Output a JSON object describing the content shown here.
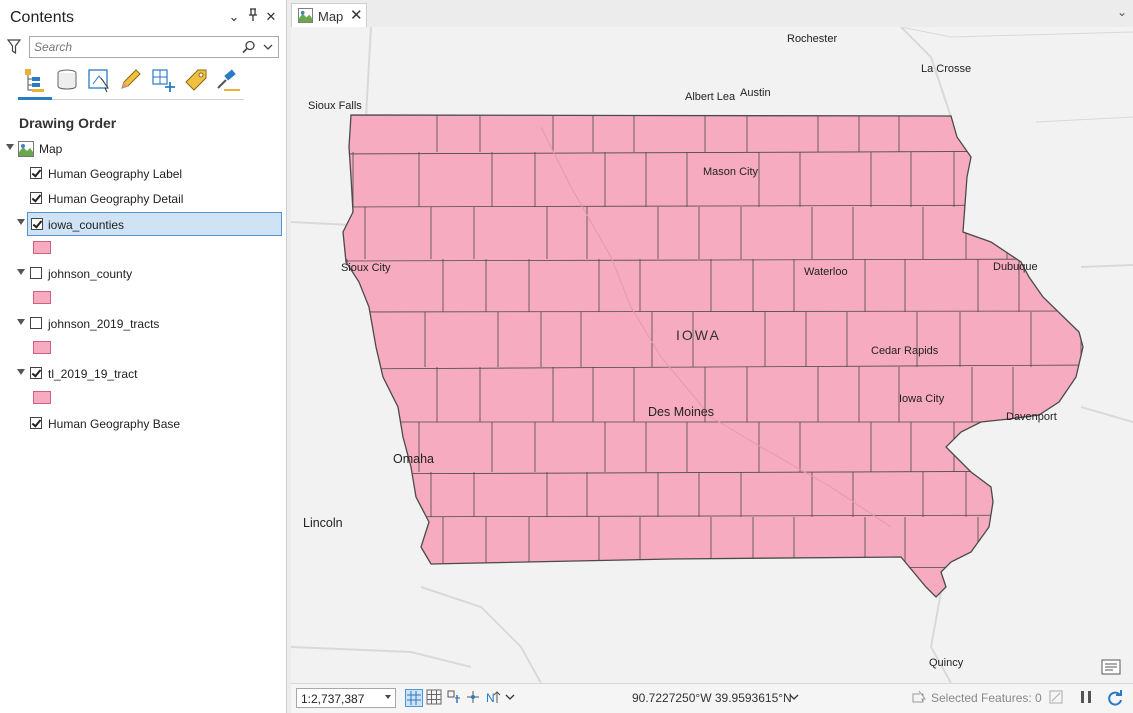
{
  "contents_pane": {
    "title": "Contents",
    "search": {
      "placeholder": "Search",
      "value": ""
    },
    "section_title": "Drawing Order",
    "map_node": "Map",
    "layers": [
      {
        "name": "Human Geography Label",
        "checked": true
      },
      {
        "name": "Human Geography Detail",
        "checked": true
      },
      {
        "name": "iowa_counties",
        "checked": true,
        "selected": true,
        "symbol_color": "#f7abc0"
      },
      {
        "name": "johnson_county",
        "checked": false,
        "symbol_color": "#f7abc0"
      },
      {
        "name": "johnson_2019_tracts",
        "checked": false,
        "symbol_color": "#f7abc0"
      },
      {
        "name": "tl_2019_19_tract",
        "checked": true,
        "symbol_color": "#f7abc0"
      },
      {
        "name": "Human Geography Base",
        "checked": true
      }
    ],
    "toolbar_icons": [
      "list-by-drawing-order-icon",
      "list-by-data-source-icon",
      "list-by-selection-icon",
      "list-by-editing-icon",
      "list-by-snapping-icon",
      "list-by-labeling-icon",
      "list-by-perspective-imagery-icon"
    ]
  },
  "map_tab": {
    "label": "Map"
  },
  "map": {
    "state_label": "IOWA",
    "county_fill": "#f7abc0",
    "county_stroke": "#4a4a4a",
    "cities": [
      {
        "name": "Rochester"
      },
      {
        "name": "La Crosse"
      },
      {
        "name": "Sioux Falls"
      },
      {
        "name": "Albert Lea"
      },
      {
        "name": "Austin"
      },
      {
        "name": "Mason City"
      },
      {
        "name": "Sioux City"
      },
      {
        "name": "Waterloo"
      },
      {
        "name": "Dubuque"
      },
      {
        "name": "Cedar Rapids"
      },
      {
        "name": "Iowa City"
      },
      {
        "name": "Des Moines"
      },
      {
        "name": "Davenport"
      },
      {
        "name": "Omaha"
      },
      {
        "name": "Lincoln"
      },
      {
        "name": "Quincy"
      }
    ]
  },
  "status_bar": {
    "scale": "1:2,737,387",
    "coordinates": "90.7227250°W 39.9593615°N",
    "selected_features": "Selected Features: 0"
  }
}
